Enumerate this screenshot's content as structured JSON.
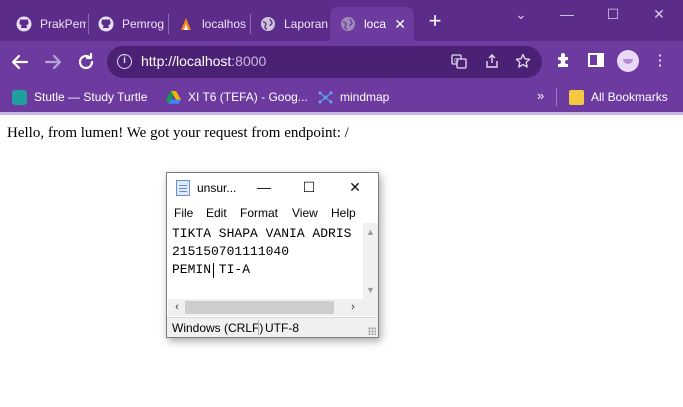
{
  "browser": {
    "tabs": [
      {
        "title": "PrakPem",
        "icon": "github-icon"
      },
      {
        "title": "Pemrog",
        "icon": "github-icon"
      },
      {
        "title": "localhos",
        "icon": "xampp-icon"
      },
      {
        "title": "Laporan",
        "icon": "globe-icon"
      },
      {
        "title": "loca",
        "icon": "globe-icon",
        "active": true
      }
    ],
    "new_tab_label": "+",
    "url_host": "http://localhost",
    "url_port": ":8000",
    "bookmarks": [
      {
        "label": "Stutle — Study Turtle",
        "icon": "stutle-icon",
        "color": "#1f9fa0"
      },
      {
        "label": "XI T6 (TEFA) - Goog...",
        "icon": "drive-icon",
        "color": "#f4b400"
      },
      {
        "label": "mindmap",
        "icon": "mindmap-icon",
        "color": "#3a7bd5"
      }
    ],
    "more_bookmarks": "»",
    "all_bookmarks": "All Bookmarks"
  },
  "page": {
    "text": "Hello, from lumen! We got your request from endpoint: /"
  },
  "notepad": {
    "title": "unsur...",
    "menu": [
      "File",
      "Edit",
      "Format",
      "View",
      "Help"
    ],
    "lines": [
      "TIKTA SHAPA VANIA ADRIS",
      "215150701111040",
      "PEMIN TI-A"
    ],
    "status_eol": "Windows (CRLF)",
    "status_encoding": "UTF-8"
  },
  "colors": {
    "frame": "#5b2c8a",
    "toolbar": "#6d3aa0",
    "omnibox": "#4a2175"
  }
}
